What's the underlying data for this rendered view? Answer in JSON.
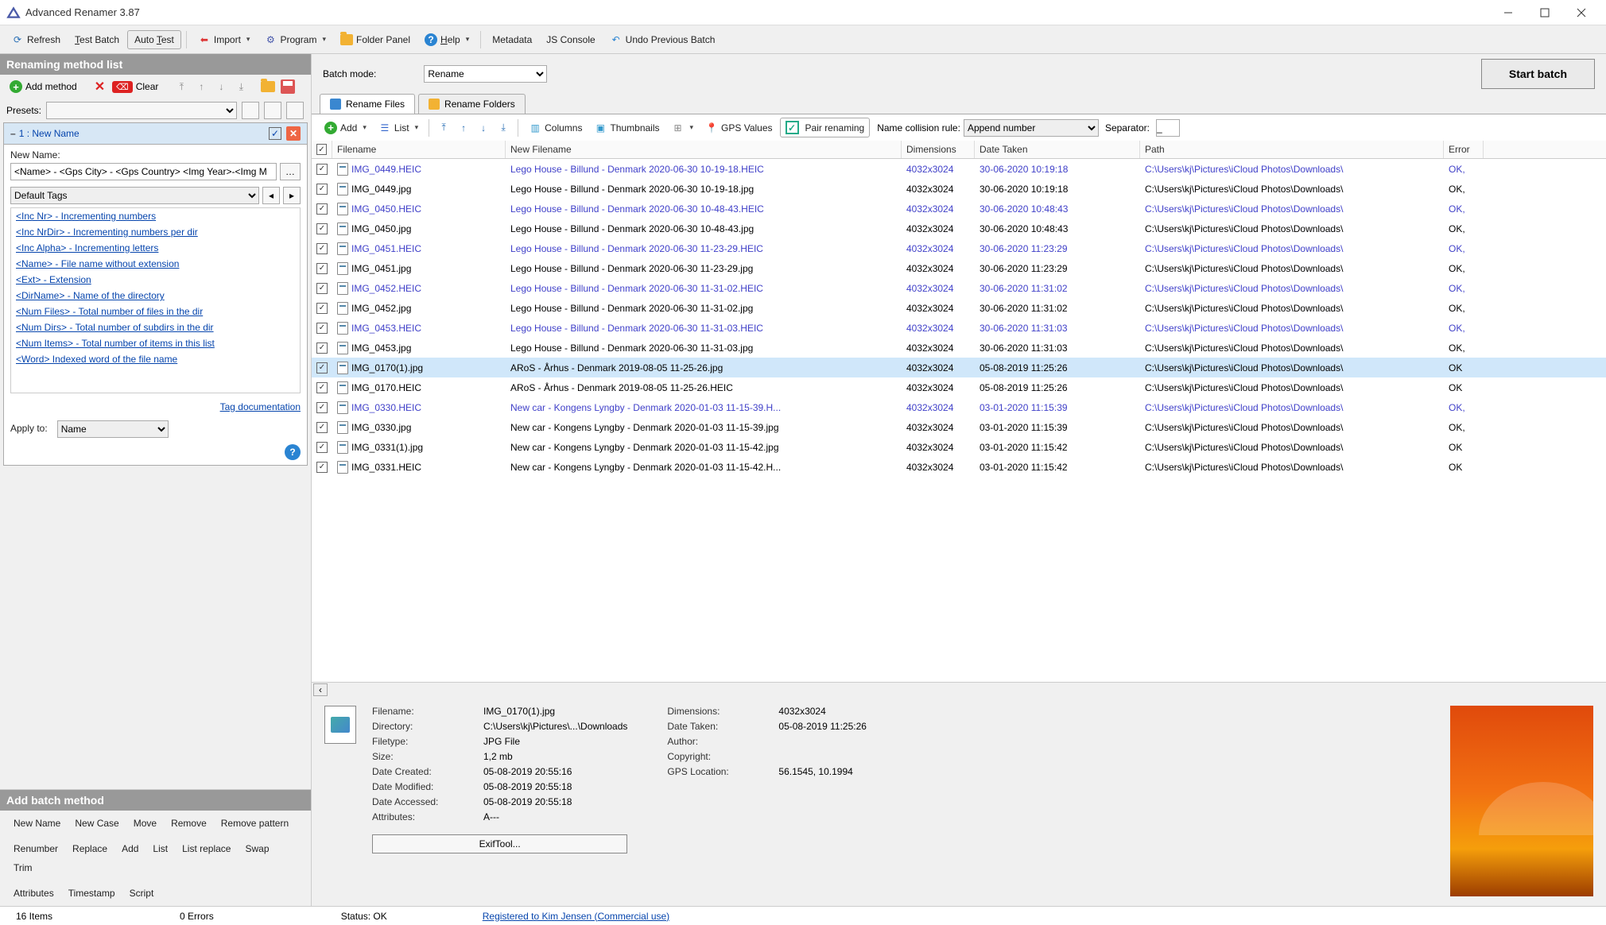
{
  "window": {
    "title": "Advanced Renamer 3.87"
  },
  "toolbar": {
    "refresh": "Refresh",
    "test_batch": "Test Batch",
    "auto_test": "Auto Test",
    "import": "Import",
    "program": "Program",
    "folder_panel": "Folder Panel",
    "help": "Help",
    "metadata": "Metadata",
    "js_console": "JS Console",
    "undo_prev": "Undo Previous Batch"
  },
  "left": {
    "header": "Renaming method list",
    "add_method": "Add method",
    "clear": "Clear",
    "presets_label": "Presets:"
  },
  "method": {
    "title": "1 : New Name",
    "new_name_label": "New Name:",
    "new_name_value": "<Name> - <Gps City> - <Gps Country> <Img Year>-<Img M",
    "default_tags": "Default Tags",
    "tags": [
      "<Inc Nr> - Incrementing numbers",
      "<Inc NrDir> - Incrementing numbers per dir",
      "<Inc Alpha> - Incrementing letters",
      "<Name> - File name without extension",
      "<Ext> - Extension",
      "<DirName> - Name of the directory",
      "<Num Files> - Total number of files in the dir",
      "<Num Dirs> - Total number of subdirs in the dir",
      "<Num Items> - Total number of items in this list",
      "<Word> Indexed word of the file name"
    ],
    "tag_doc": "Tag documentation",
    "apply_label": "Apply to:",
    "apply_value": "Name"
  },
  "batch_panel": {
    "header": "Add batch method",
    "row1": [
      "New Name",
      "New Case",
      "Move",
      "Remove",
      "Remove pattern"
    ],
    "row2": [
      "Renumber",
      "Replace",
      "Add",
      "List",
      "List replace",
      "Swap",
      "Trim"
    ],
    "row3": [
      "Attributes",
      "Timestamp",
      "Script"
    ]
  },
  "right": {
    "batch_mode_label": "Batch mode:",
    "batch_mode_value": "Rename",
    "start_batch": "Start batch",
    "tab_files": "Rename Files",
    "tab_folders": "Rename Folders",
    "file_toolbar": {
      "add": "Add",
      "list": "List",
      "columns": "Columns",
      "thumbnails": "Thumbnails",
      "gps": "GPS Values",
      "pair": "Pair renaming",
      "ncr_label": "Name collision rule:",
      "ncr_value": "Append number",
      "sep_label": "Separator:",
      "sep_value": "_"
    }
  },
  "columns": {
    "filename": "Filename",
    "newfile": "New Filename",
    "dim": "Dimensions",
    "date": "Date Taken",
    "path": "Path",
    "error": "Error"
  },
  "rows": [
    {
      "file": "IMG_0449.HEIC",
      "new": "Lego House - Billund - Denmark 2020-06-30 10-19-18.HEIC",
      "dim": "4032x3024",
      "date": "30-06-2020 10:19:18",
      "path": "C:\\Users\\kj\\Pictures\\iCloud Photos\\Downloads\\",
      "err": "OK,",
      "link": true
    },
    {
      "file": "IMG_0449.jpg",
      "new": "Lego House - Billund - Denmark 2020-06-30 10-19-18.jpg",
      "dim": "4032x3024",
      "date": "30-06-2020 10:19:18",
      "path": "C:\\Users\\kj\\Pictures\\iCloud Photos\\Downloads\\",
      "err": "OK,",
      "link": false
    },
    {
      "file": "IMG_0450.HEIC",
      "new": "Lego House - Billund - Denmark 2020-06-30 10-48-43.HEIC",
      "dim": "4032x3024",
      "date": "30-06-2020 10:48:43",
      "path": "C:\\Users\\kj\\Pictures\\iCloud Photos\\Downloads\\",
      "err": "OK,",
      "link": true
    },
    {
      "file": "IMG_0450.jpg",
      "new": "Lego House - Billund - Denmark 2020-06-30 10-48-43.jpg",
      "dim": "4032x3024",
      "date": "30-06-2020 10:48:43",
      "path": "C:\\Users\\kj\\Pictures\\iCloud Photos\\Downloads\\",
      "err": "OK,",
      "link": false
    },
    {
      "file": "IMG_0451.HEIC",
      "new": "Lego House - Billund - Denmark 2020-06-30 11-23-29.HEIC",
      "dim": "4032x3024",
      "date": "30-06-2020 11:23:29",
      "path": "C:\\Users\\kj\\Pictures\\iCloud Photos\\Downloads\\",
      "err": "OK,",
      "link": true
    },
    {
      "file": "IMG_0451.jpg",
      "new": "Lego House - Billund - Denmark 2020-06-30 11-23-29.jpg",
      "dim": "4032x3024",
      "date": "30-06-2020 11:23:29",
      "path": "C:\\Users\\kj\\Pictures\\iCloud Photos\\Downloads\\",
      "err": "OK,",
      "link": false
    },
    {
      "file": "IMG_0452.HEIC",
      "new": "Lego House - Billund - Denmark 2020-06-30 11-31-02.HEIC",
      "dim": "4032x3024",
      "date": "30-06-2020 11:31:02",
      "path": "C:\\Users\\kj\\Pictures\\iCloud Photos\\Downloads\\",
      "err": "OK,",
      "link": true
    },
    {
      "file": "IMG_0452.jpg",
      "new": "Lego House - Billund - Denmark 2020-06-30 11-31-02.jpg",
      "dim": "4032x3024",
      "date": "30-06-2020 11:31:02",
      "path": "C:\\Users\\kj\\Pictures\\iCloud Photos\\Downloads\\",
      "err": "OK,",
      "link": false
    },
    {
      "file": "IMG_0453.HEIC",
      "new": "Lego House - Billund - Denmark 2020-06-30 11-31-03.HEIC",
      "dim": "4032x3024",
      "date": "30-06-2020 11:31:03",
      "path": "C:\\Users\\kj\\Pictures\\iCloud Photos\\Downloads\\",
      "err": "OK,",
      "link": true
    },
    {
      "file": "IMG_0453.jpg",
      "new": "Lego House - Billund - Denmark 2020-06-30 11-31-03.jpg",
      "dim": "4032x3024",
      "date": "30-06-2020 11:31:03",
      "path": "C:\\Users\\kj\\Pictures\\iCloud Photos\\Downloads\\",
      "err": "OK,",
      "link": false
    },
    {
      "file": "IMG_0170(1).jpg",
      "new": "ARoS - Århus - Denmark 2019-08-05 11-25-26.jpg",
      "dim": "4032x3024",
      "date": "05-08-2019 11:25:26",
      "path": "C:\\Users\\kj\\Pictures\\iCloud Photos\\Downloads\\",
      "err": "OK",
      "link": false,
      "selected": true
    },
    {
      "file": "IMG_0170.HEIC",
      "new": "ARoS - Århus - Denmark 2019-08-05 11-25-26.HEIC",
      "dim": "4032x3024",
      "date": "05-08-2019 11:25:26",
      "path": "C:\\Users\\kj\\Pictures\\iCloud Photos\\Downloads\\",
      "err": "OK",
      "link": false
    },
    {
      "file": "IMG_0330.HEIC",
      "new": "New car - Kongens Lyngby - Denmark 2020-01-03 11-15-39.H...",
      "dim": "4032x3024",
      "date": "03-01-2020 11:15:39",
      "path": "C:\\Users\\kj\\Pictures\\iCloud Photos\\Downloads\\",
      "err": "OK,",
      "link": true
    },
    {
      "file": "IMG_0330.jpg",
      "new": "New car - Kongens Lyngby - Denmark 2020-01-03 11-15-39.jpg",
      "dim": "4032x3024",
      "date": "03-01-2020 11:15:39",
      "path": "C:\\Users\\kj\\Pictures\\iCloud Photos\\Downloads\\",
      "err": "OK,",
      "link": false
    },
    {
      "file": "IMG_0331(1).jpg",
      "new": "New car - Kongens Lyngby - Denmark 2020-01-03 11-15-42.jpg",
      "dim": "4032x3024",
      "date": "03-01-2020 11:15:42",
      "path": "C:\\Users\\kj\\Pictures\\iCloud Photos\\Downloads\\",
      "err": "OK",
      "link": false
    },
    {
      "file": "IMG_0331.HEIC",
      "new": "New car - Kongens Lyngby - Denmark 2020-01-03 11-15-42.H...",
      "dim": "4032x3024",
      "date": "03-01-2020 11:15:42",
      "path": "C:\\Users\\kj\\Pictures\\iCloud Photos\\Downloads\\",
      "err": "OK",
      "link": false
    }
  ],
  "details": {
    "filename_l": "Filename:",
    "filename_v": "IMG_0170(1).jpg",
    "directory_l": "Directory:",
    "directory_v": "C:\\Users\\kj\\Pictures\\...\\Downloads",
    "filetype_l": "Filetype:",
    "filetype_v": "JPG File",
    "size_l": "Size:",
    "size_v": "1,2 mb",
    "created_l": "Date Created:",
    "created_v": "05-08-2019 20:55:16",
    "modified_l": "Date Modified:",
    "modified_v": "05-08-2019 20:55:18",
    "accessed_l": "Date Accessed:",
    "accessed_v": "05-08-2019 20:55:18",
    "attrs_l": "Attributes:",
    "attrs_v": "A---",
    "dim_l": "Dimensions:",
    "dim_v": "4032x3024",
    "taken_l": "Date Taken:",
    "taken_v": "05-08-2019 11:25:26",
    "author_l": "Author:",
    "author_v": "",
    "copyright_l": "Copyright:",
    "copyright_v": "",
    "gps_l": "GPS Location:",
    "gps_v": "56.1545, 10.1994",
    "exif": "ExifTool..."
  },
  "status": {
    "items": "16 Items",
    "errors": "0 Errors",
    "status": "Status: OK",
    "registered": "Registered to Kim Jensen (Commercial use)"
  }
}
